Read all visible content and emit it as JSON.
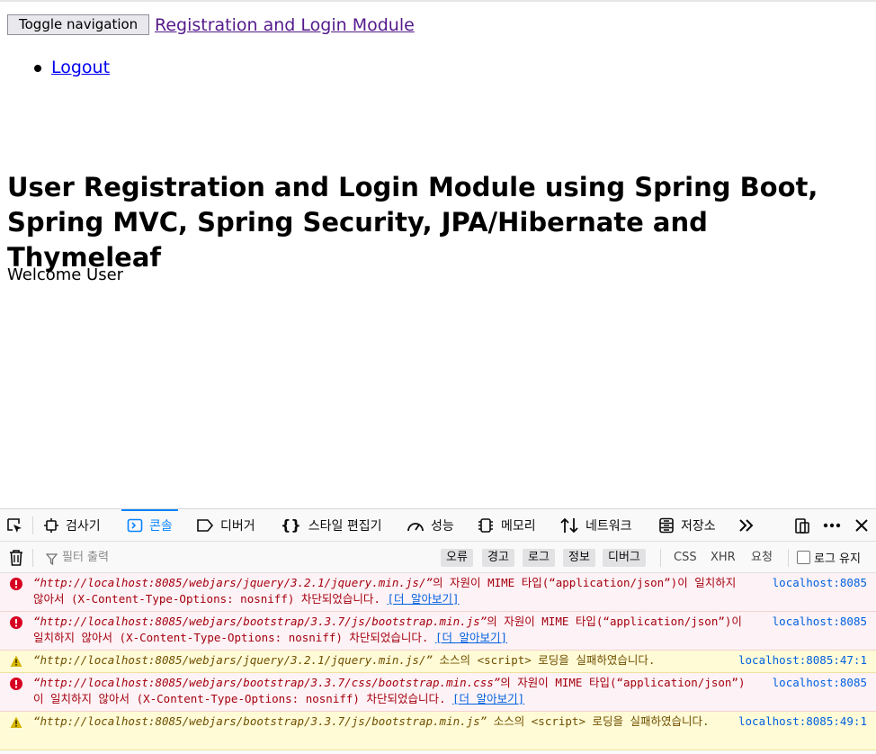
{
  "page": {
    "toggle_label": "Toggle navigation",
    "brand": "Registration and Login Module",
    "nav_items": [
      {
        "label": "Logout"
      }
    ],
    "heading": "User Registration and Login Module using Spring Boot, Spring MVC, Spring Security, JPA/Hibernate and Thymeleaf",
    "welcome": "Welcome User"
  },
  "devtools": {
    "tabs": [
      {
        "label": "검사기",
        "icon": "inspector-icon"
      },
      {
        "label": "콘솔",
        "icon": "console-icon",
        "active": true
      },
      {
        "label": "디버거",
        "icon": "debugger-icon"
      },
      {
        "label": "스타일 편집기",
        "icon": "style-editor-icon"
      },
      {
        "label": "성능",
        "icon": "performance-icon"
      },
      {
        "label": "메모리",
        "icon": "memory-icon"
      },
      {
        "label": "네트워크",
        "icon": "network-icon"
      },
      {
        "label": "저장소",
        "icon": "storage-icon"
      }
    ],
    "accent_color": "#0a84ff",
    "toolbar": {
      "filter_placeholder": "필터 출력",
      "levels": [
        "오류",
        "경고",
        "로그",
        "정보",
        "디버그"
      ],
      "requests": [
        "CSS",
        "XHR",
        "요청"
      ],
      "persist_label": "로그 유지"
    },
    "messages": [
      {
        "level": "error",
        "url": "“http://localhost:8085/webjars/jquery/3.2.1/jquery.min.js/”",
        "text": "의 자원이 MIME 타입(“application/json”)이 일치하지 않아서 (X-Content-Type-Options: nosniff) 차단되었습니다.",
        "learn_more": "[더 알아보기]",
        "location": "localhost:8085"
      },
      {
        "level": "error",
        "url": "“http://localhost:8085/webjars/bootstrap/3.3.7/js/bootstrap.min.js”",
        "text": "의 자원이 MIME 타입(“application/json”)이 일치하지 않아서 (X-Content-Type-Options: nosniff) 차단되었습니다.",
        "learn_more": "[더 알아보기]",
        "location": "localhost:8085"
      },
      {
        "level": "warn",
        "url": "“http://localhost:8085/webjars/jquery/3.2.1/jquery.min.js/”",
        "text": " 소스의 <script> 로딩을 실패하였습니다.",
        "learn_more": "",
        "location": "localhost:8085:47:1"
      },
      {
        "level": "error",
        "url": "“http://localhost:8085/webjars/bootstrap/3.3.7/css/bootstrap.min.css”",
        "text": "의 자원이 MIME 타입(“application/json”)이 일치하지 않아서 (X-Content-Type-Options: nosniff) 차단되었습니다.",
        "learn_more": "[더 알아보기]",
        "location": "localhost:8085"
      },
      {
        "level": "warn",
        "url": "“http://localhost:8085/webjars/bootstrap/3.3.7/js/bootstrap.min.js”",
        "text": " 소스의 <script> 로딩을 실패하였습니다.",
        "learn_more": "",
        "location": "localhost:8085:49:1"
      }
    ],
    "colors": {
      "error_bg": "#fdf2f5",
      "error_text": "#a4000f",
      "warn_bg": "#fffbd6",
      "warn_text": "#6f4f00"
    }
  }
}
